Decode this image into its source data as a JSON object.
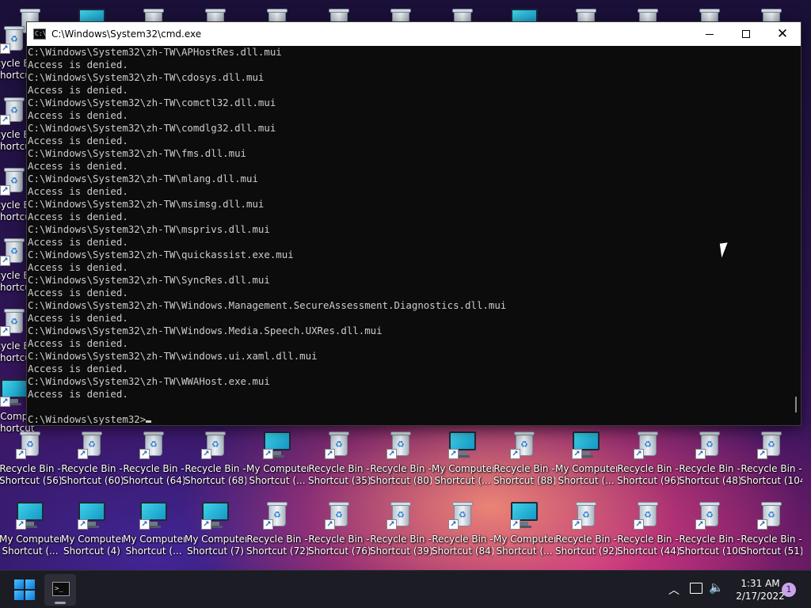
{
  "desktop": {
    "left_column": [
      {
        "label": "Recycle Bin - Shortcut",
        "icon": "recycle-bin"
      },
      {
        "label": "Recycle Bin - Shortcut",
        "icon": "recycle-bin"
      },
      {
        "label": "Recycle Bin - Shortcut",
        "icon": "recycle-bin"
      },
      {
        "label": "Recycle Bin - Shortcut",
        "icon": "recycle-bin"
      },
      {
        "label": "Recycle Bin - Shortcut",
        "icon": "recycle-bin"
      },
      {
        "label": "My Computer - Shortcut",
        "icon": "computer"
      }
    ],
    "row1": [
      {
        "label": "Recycle Bin - Shortcut (56)",
        "icon": "recycle-bin"
      },
      {
        "label": "Recycle Bin - Shortcut (60)",
        "icon": "recycle-bin"
      },
      {
        "label": "Recycle Bin - Shortcut (64)",
        "icon": "recycle-bin"
      },
      {
        "label": "Recycle Bin - Shortcut (68)",
        "icon": "recycle-bin"
      },
      {
        "label": "My Computer - Shortcut (...",
        "icon": "computer"
      },
      {
        "label": "Recycle Bin - Shortcut (35)",
        "icon": "recycle-bin"
      },
      {
        "label": "Recycle Bin - Shortcut (80)",
        "icon": "recycle-bin"
      },
      {
        "label": "My Computer - Shortcut (...",
        "icon": "computer"
      },
      {
        "label": "Recycle Bin - Shortcut (88)",
        "icon": "recycle-bin"
      },
      {
        "label": "My Computer - Shortcut (...",
        "icon": "computer"
      },
      {
        "label": "Recycle Bin - Shortcut (96)",
        "icon": "recycle-bin"
      },
      {
        "label": "Recycle Bin - Shortcut (48)",
        "icon": "recycle-bin"
      },
      {
        "label": "Recycle Bin - Shortcut (104)",
        "icon": "recycle-bin"
      }
    ],
    "row2": [
      {
        "label": "My Computer - Shortcut (...",
        "icon": "computer"
      },
      {
        "label": "My Computer - Shortcut (4)",
        "icon": "computer"
      },
      {
        "label": "My Computer - Shortcut (...",
        "icon": "computer"
      },
      {
        "label": "My Computer - Shortcut (7)",
        "icon": "computer"
      },
      {
        "label": "Recycle Bin - Shortcut (72)",
        "icon": "recycle-bin"
      },
      {
        "label": "Recycle Bin - Shortcut (76)",
        "icon": "recycle-bin"
      },
      {
        "label": "Recycle Bin - Shortcut (39)",
        "icon": "recycle-bin"
      },
      {
        "label": "Recycle Bin - Shortcut (84)",
        "icon": "recycle-bin"
      },
      {
        "label": "My Computer - Shortcut (...",
        "icon": "computer"
      },
      {
        "label": "Recycle Bin - Shortcut (92)",
        "icon": "recycle-bin"
      },
      {
        "label": "Recycle Bin - Shortcut (44)",
        "icon": "recycle-bin"
      },
      {
        "label": "Recycle Bin - Shortcut (100)",
        "icon": "recycle-bin"
      },
      {
        "label": "Recycle Bin - Shortcut (51)",
        "icon": "recycle-bin"
      }
    ]
  },
  "cmd": {
    "title": "C:\\Windows\\System32\\cmd.exe",
    "lines": [
      "C:\\Windows\\System32\\zh-TW\\APHostRes.dll.mui",
      "Access is denied.",
      "C:\\Windows\\System32\\zh-TW\\cdosys.dll.mui",
      "Access is denied.",
      "C:\\Windows\\System32\\zh-TW\\comctl32.dll.mui",
      "Access is denied.",
      "C:\\Windows\\System32\\zh-TW\\comdlg32.dll.mui",
      "Access is denied.",
      "C:\\Windows\\System32\\zh-TW\\fms.dll.mui",
      "Access is denied.",
      "C:\\Windows\\System32\\zh-TW\\mlang.dll.mui",
      "Access is denied.",
      "C:\\Windows\\System32\\zh-TW\\msimsg.dll.mui",
      "Access is denied.",
      "C:\\Windows\\System32\\zh-TW\\msprivs.dll.mui",
      "Access is denied.",
      "C:\\Windows\\System32\\zh-TW\\quickassist.exe.mui",
      "Access is denied.",
      "C:\\Windows\\System32\\zh-TW\\SyncRes.dll.mui",
      "Access is denied.",
      "C:\\Windows\\System32\\zh-TW\\Windows.Management.SecureAssessment.Diagnostics.dll.mui",
      "Access is denied.",
      "C:\\Windows\\System32\\zh-TW\\Windows.Media.Speech.UXRes.dll.mui",
      "Access is denied.",
      "C:\\Windows\\System32\\zh-TW\\windows.ui.xaml.dll.mui",
      "Access is denied.",
      "C:\\Windows\\System32\\zh-TW\\WWAHost.exe.mui",
      "Access is denied.",
      ""
    ],
    "prompt": "C:\\Windows\\system32>"
  },
  "taskbar": {
    "time": "1:31 AM",
    "date": "2/17/2022",
    "notification_count": "1"
  }
}
